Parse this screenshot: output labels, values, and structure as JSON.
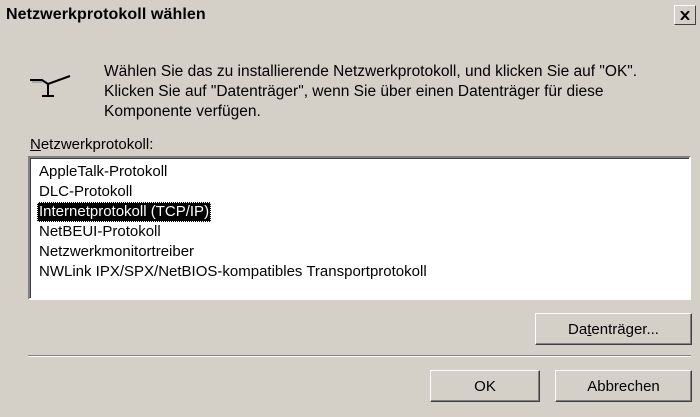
{
  "dialog": {
    "title": "Netzwerkprotokoll wählen",
    "close_glyph": "×",
    "icon": "network-protocol-icon",
    "intro_text": "Wählen Sie das zu installierende Netzwerkprotokoll, und klicken Sie auf \"OK\". Klicken Sie auf \"Datenträger\", wenn Sie über einen Datenträger für diese Komponente verfügen.",
    "list_label_prefix": "N",
    "list_label_rest": "etzwerkprotokoll:",
    "protocols": [
      {
        "label": "AppleTalk-Protokoll",
        "selected": false
      },
      {
        "label": "DLC-Protokoll",
        "selected": false
      },
      {
        "label": "Internetprotokoll (TCP/IP)",
        "selected": true
      },
      {
        "label": "NetBEUI-Protokoll",
        "selected": false
      },
      {
        "label": "Netzwerkmonitortreiber",
        "selected": false
      },
      {
        "label": "NWLink IPX/SPX/NetBIOS-kompatibles Transportprotokoll",
        "selected": false
      }
    ],
    "buttons": {
      "disk_pre": "Da",
      "disk_accel": "t",
      "disk_post": "enträger...",
      "ok": "OK",
      "cancel": "Abbrechen"
    }
  },
  "colors": {
    "face": "#d4d0c8",
    "selection_bg": "#000000",
    "selection_fg": "#ffffff"
  }
}
